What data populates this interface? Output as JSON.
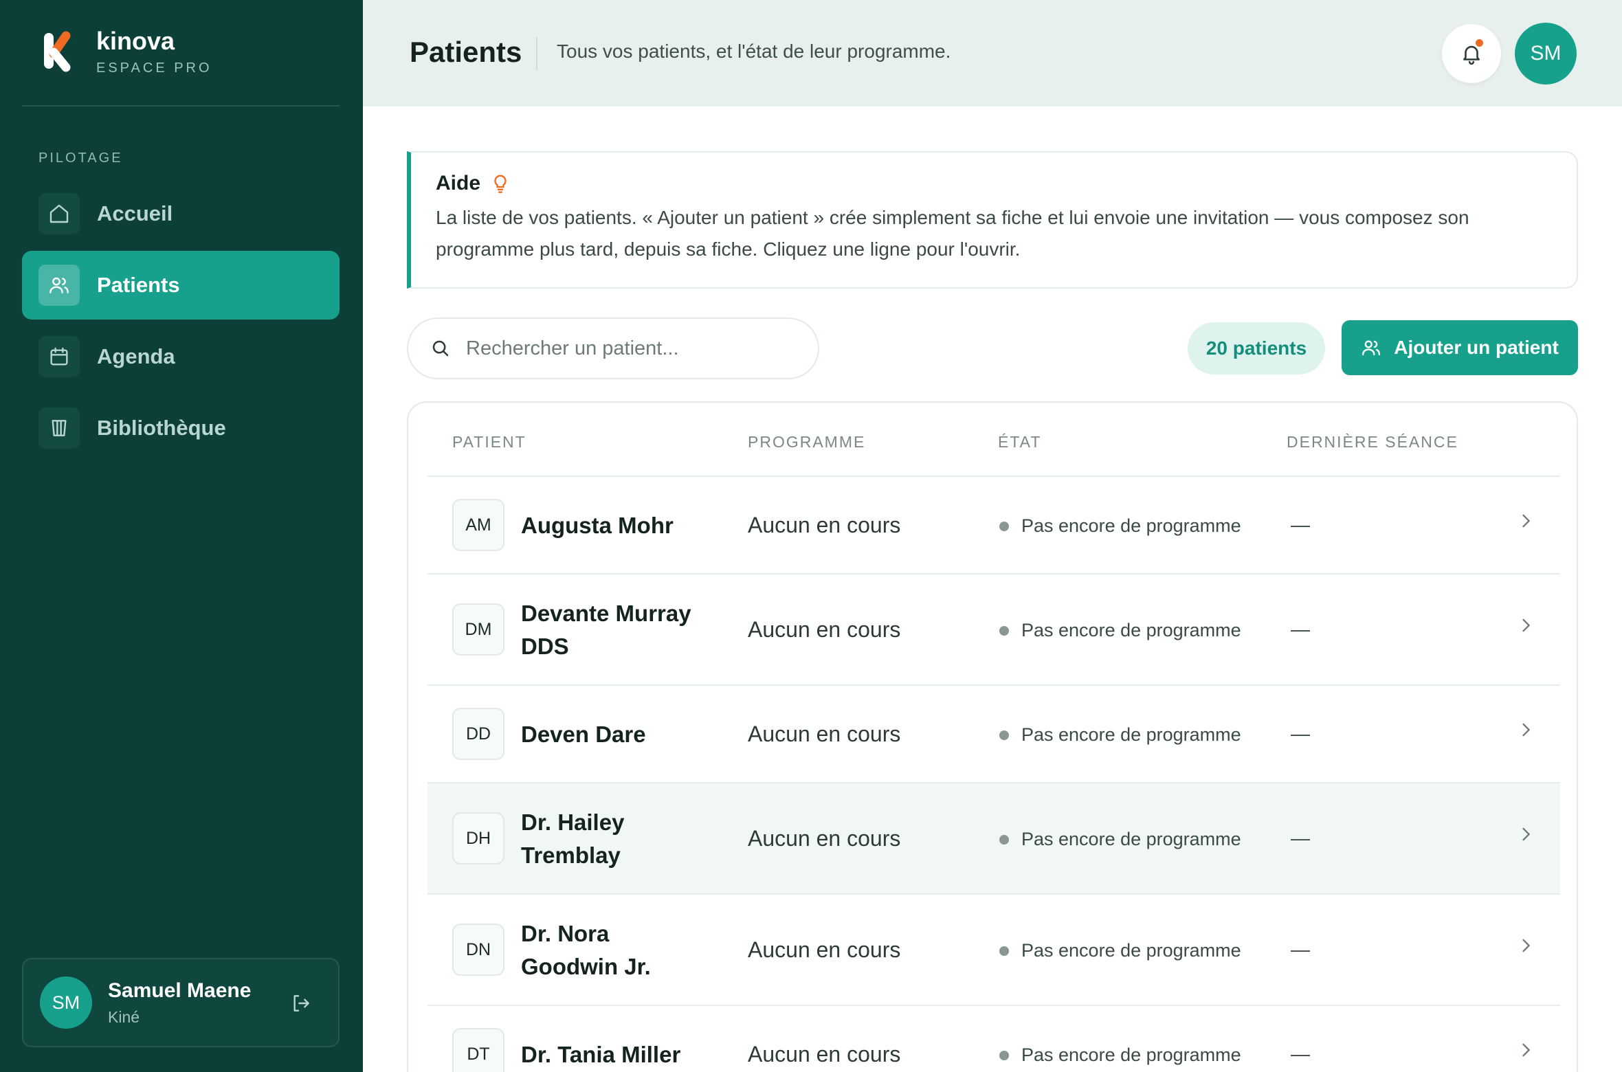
{
  "brand": {
    "name": "kinova",
    "subtitle": "ESPACE PRO"
  },
  "sidebar": {
    "section_label": "PILOTAGE",
    "items": [
      {
        "label": "Accueil",
        "icon": "home-icon",
        "active": false
      },
      {
        "label": "Patients",
        "icon": "users-icon",
        "active": true
      },
      {
        "label": "Agenda",
        "icon": "calendar-icon",
        "active": false
      },
      {
        "label": "Bibliothèque",
        "icon": "library-icon",
        "active": false
      }
    ],
    "user": {
      "initials": "SM",
      "name": "Samuel Maene",
      "role": "Kiné"
    }
  },
  "header": {
    "title": "Patients",
    "subtitle": "Tous vos patients, et l'état de leur programme.",
    "avatar_initials": "SM"
  },
  "help": {
    "title": "Aide",
    "text": "La liste de vos patients. « Ajouter un patient » crée simplement sa fiche et lui envoie une invitation — vous composez son programme plus tard, depuis sa fiche. Cliquez une ligne pour l'ouvrir."
  },
  "toolbar": {
    "search_placeholder": "Rechercher un patient...",
    "count_label": "20 patients",
    "add_label": "Ajouter un patient"
  },
  "table": {
    "headers": {
      "patient": "PATIENT",
      "programme": "PROGRAMME",
      "etat": "ÉTAT",
      "derniere": "DERNIÈRE SÉANCE"
    },
    "rows": [
      {
        "initials": "AM",
        "name": "Augusta Mohr",
        "programme": "Aucun en cours",
        "etat": "Pas encore de programme",
        "derniere": "—"
      },
      {
        "initials": "DM",
        "name": "Devante Murray DDS",
        "programme": "Aucun en cours",
        "etat": "Pas encore de programme",
        "derniere": "—"
      },
      {
        "initials": "DD",
        "name": "Deven Dare",
        "programme": "Aucun en cours",
        "etat": "Pas encore de programme",
        "derniere": "—"
      },
      {
        "initials": "DH",
        "name": "Dr. Hailey Tremblay",
        "programme": "Aucun en cours",
        "etat": "Pas encore de programme",
        "derniere": "—"
      },
      {
        "initials": "DN",
        "name": "Dr. Nora Goodwin Jr.",
        "programme": "Aucun en cours",
        "etat": "Pas encore de programme",
        "derniere": "—"
      },
      {
        "initials": "DT",
        "name": "Dr. Tania Miller",
        "programme": "Aucun en cours",
        "etat": "Pas encore de programme",
        "derniere": "—"
      }
    ]
  },
  "colors": {
    "sidebar": "#0c3f38",
    "accent": "#17a18d",
    "notification": "#ef6a22"
  }
}
